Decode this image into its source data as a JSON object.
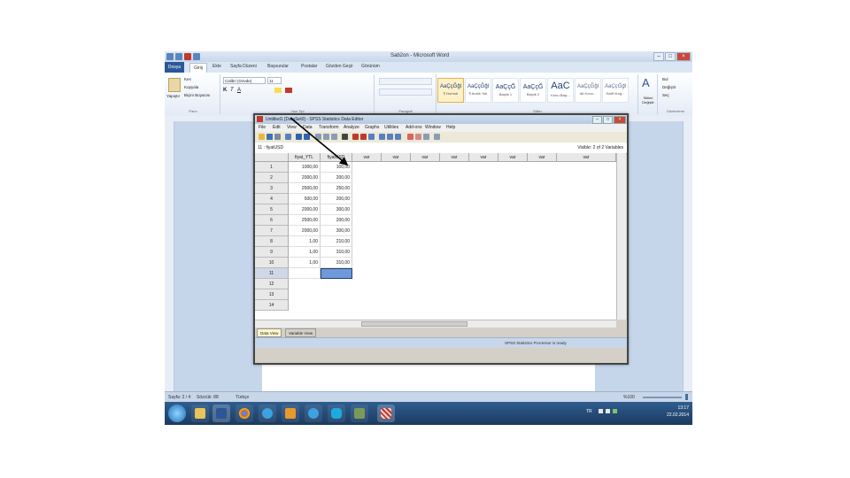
{
  "word": {
    "title": "Sab2on - Microsoft Word",
    "file_tab": "Dosya",
    "tabs": [
      "Giriş",
      "Ekle",
      "Sayfa Düzeni",
      "Başvurular",
      "Postalar",
      "Gözden Geçir",
      "Görünüm"
    ],
    "active_tab": "Giriş",
    "font_name": "Calibri (Gövde)",
    "font_size": "11",
    "clipboard_items": [
      "Kes",
      "Kopyala",
      "Biçim Boyacısı"
    ],
    "paste_label": "Yapıştır",
    "group_labels": [
      "Pano",
      "Yazı Tipi",
      "Paragraf",
      "Stiller",
      "Düzenleme"
    ],
    "styles": [
      {
        "preview": "AaÇçĞğl",
        "name": "¶ Normal"
      },
      {
        "preview": "AaÇçĞğl",
        "name": "¶ Aralık Yok"
      },
      {
        "preview": "AaÇçĞ",
        "name": "Başlık 1"
      },
      {
        "preview": "AaÇçĞ",
        "name": "Başlık 2"
      },
      {
        "preview": "AaC",
        "name": "Konu Başl..."
      },
      {
        "preview": "AaÇçĞğl",
        "name": "Alt Konu..."
      },
      {
        "preview": "AaÇçĞğl",
        "name": "Hafif Vurg..."
      }
    ],
    "change_styles": "Stilleri Değiştir",
    "editing": [
      "Bul",
      "Değiştir",
      "Seç"
    ],
    "status_page": "Sayfa: 2 / 4",
    "status_words": "Sözcük: 88",
    "status_lang": "Türkçe",
    "zoom": "%100"
  },
  "spss": {
    "title": "Untitled1 [DataSet0] - SPSS Statistics Data Editor",
    "menu": [
      "File",
      "Edit",
      "View",
      "Data",
      "Transform",
      "Analyze",
      "Graphs",
      "Utilities",
      "Add-ons",
      "Window",
      "Help"
    ],
    "cell_ref": "11 : fiyatUSD",
    "visible": "Visible: 2 of 2 Variables",
    "columns": [
      "fiyat_YTL",
      "fiyatUSD",
      "var",
      "var",
      "var",
      "var",
      "var",
      "var",
      "var",
      "var"
    ],
    "rows": [
      {
        "n": "1",
        "a": "1000,00",
        "b": "100,00"
      },
      {
        "n": "2",
        "a": "2000,00",
        "b": "200,00"
      },
      {
        "n": "3",
        "a": "2500,00",
        "b": "250,00"
      },
      {
        "n": "4",
        "a": "500,00",
        "b": "200,00"
      },
      {
        "n": "5",
        "a": "2000,00",
        "b": "300,00"
      },
      {
        "n": "6",
        "a": "2500,00",
        "b": "200,00"
      },
      {
        "n": "7",
        "a": "2000,00",
        "b": "300,00"
      },
      {
        "n": "8",
        "a": "1,00",
        "b": "210,00"
      },
      {
        "n": "9",
        "a": "1,00",
        "b": "310,00"
      },
      {
        "n": "10",
        "a": "1,00",
        "b": "310,00"
      },
      {
        "n": "11",
        "a": "",
        "b": ""
      },
      {
        "n": "12",
        "a": "",
        "b": ""
      },
      {
        "n": "13",
        "a": "",
        "b": ""
      },
      {
        "n": "14",
        "a": "",
        "b": ""
      }
    ],
    "view_tabs": [
      "Data View",
      "Variable View"
    ],
    "status": "SPSS Statistics Processor is ready"
  },
  "taskbar": {
    "lang": "TR",
    "time": "13:17",
    "date": "22.02.2014"
  },
  "colors": {
    "word_blue": "#2b5797",
    "spss_selection": "#6f9ad9",
    "taskbar": "#1c3a60"
  }
}
